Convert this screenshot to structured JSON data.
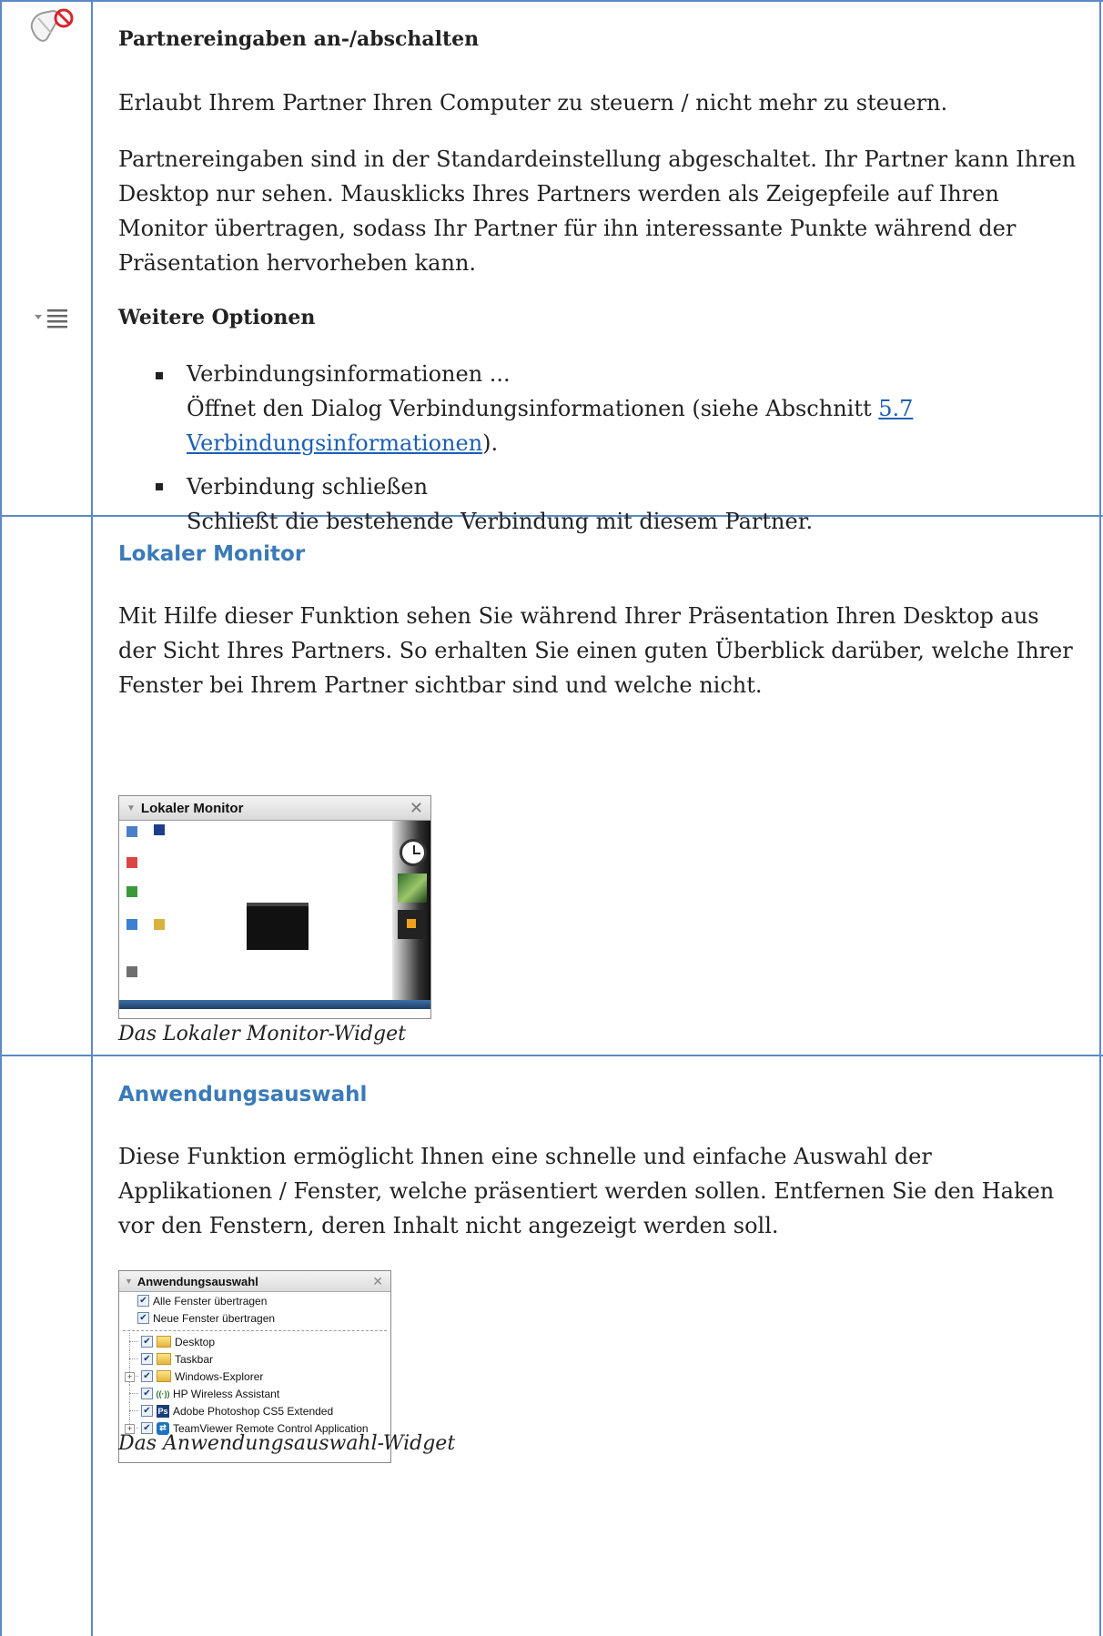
{
  "section1": {
    "title": "Partnereingaben an-/abschalten",
    "p1": "Erlaubt Ihrem Partner Ihren Computer zu steuern / nicht mehr zu steuern.",
    "p2_lines": [
      "Partnereingaben sind in der Standardeinstellung abgeschaltet. Ihr Partner kann Ihren",
      "Desktop nur sehen. Mausklicks Ihres Partners werden als Zeigepfeile auf Ihren",
      "Monitor übertragen, sodass Ihr Partner für ihn interessante Punkte während der",
      "Präsentation hervorheben kann."
    ]
  },
  "section2": {
    "title": "Weitere Optionen",
    "item1_title": "Verbindungsinformationen ...",
    "item1_line1": "Öffnet den Dialog Verbindungsinformationen (siehe Abschnitt ",
    "item1_link1": "5.7",
    "item1_link2": "Verbindungsinformationen",
    "item1_tail": ").",
    "item2_title": "Verbindung schließen",
    "item2_desc": "Schließt die bestehende Verbindung mit diesem Partner."
  },
  "section3": {
    "title": "Lokaler Monitor",
    "p_lines": [
      "Mit Hilfe dieser Funktion sehen Sie während Ihrer Präsentation Ihren Desktop aus",
      "der Sicht Ihres Partners. So erhalten Sie einen guten Überblick darüber, welche Ihrer",
      "Fenster bei Ihrem Partner sichtbar sind und welche nicht."
    ],
    "widget_title": "Lokaler Monitor",
    "caption": "Das Lokaler Monitor-Widget"
  },
  "section4": {
    "title": "Anwendungsauswahl",
    "p_lines": [
      "Diese Funktion ermöglicht Ihnen eine schnelle und einfache Auswahl der",
      "Applikationen / Fenster, welche präsentiert werden sollen. Entfernen Sie den Haken",
      "vor den Fenstern, deren Inhalt nicht angezeigt werden soll."
    ],
    "widget_title": "Anwendungsauswahl",
    "opt_all": "Alle Fenster übertragen",
    "opt_new": "Neue Fenster übertragen",
    "items": [
      "Desktop",
      "Taskbar",
      "Windows-Explorer",
      "HP Wireless Assistant",
      "Adobe Photoshop CS5 Extended",
      "TeamViewer Remote Control Application"
    ],
    "caption": "Das Anwendungsauswahl-Widget"
  },
  "colors": {
    "border": "#5b8ac6",
    "heading": "#3a7ab8",
    "link": "#1a5fb4"
  }
}
